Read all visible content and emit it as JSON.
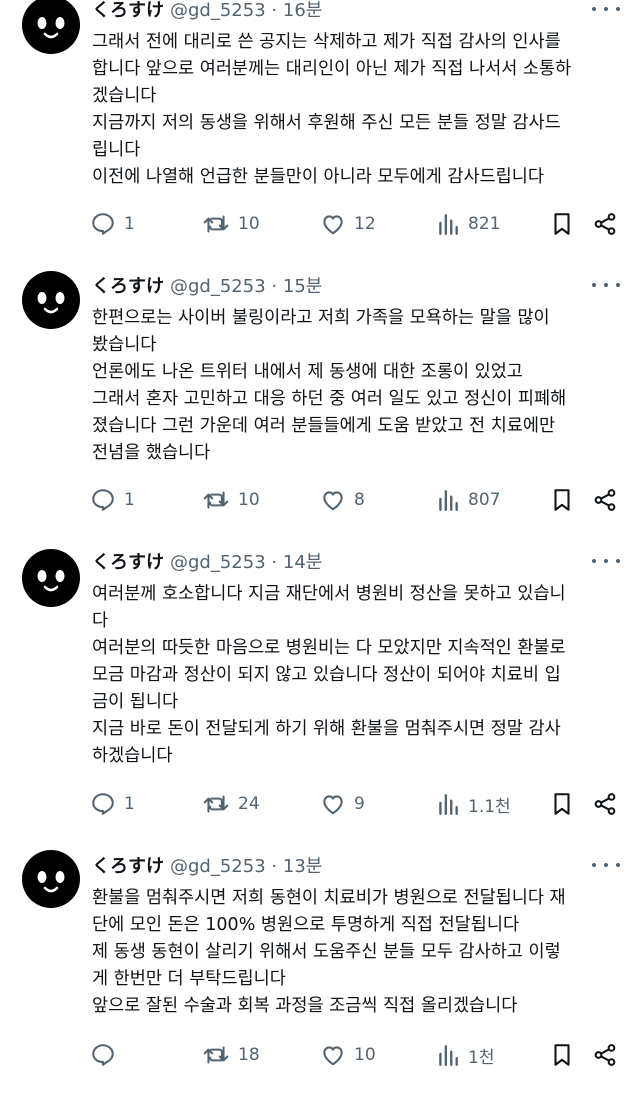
{
  "tweets": [
    {
      "name": "くろすけ",
      "handle": "@gd_5253",
      "dot": "·",
      "time": "16분",
      "lines": [
        "그래서 전에 대리로 쓴 공지는 삭제하고 제가 직접 감사의 인사를",
        "합니다 앞으로 여러분께는 대리인이 아닌 제가 직접 나서서 소통하",
        "겠습니다",
        "지금까지 저의 동생을 위해서 후원해 주신 모든 분들 정말 감사드",
        "립니다",
        "이전에 나열해 언급한 분들만이 아니라 모두에게 감사드립니다"
      ],
      "replies": "1",
      "retweets": "10",
      "likes": "12",
      "views": "821"
    },
    {
      "name": "くろすけ",
      "handle": "@gd_5253",
      "dot": "·",
      "time": "15분",
      "lines": [
        "한편으로는 사이버 불링이라고  저희 가족을 모욕하는 말을 많이",
        "봤습니다",
        "언론에도 나온 트위터 내에서 제 동생에 대한 조롱이 있었고",
        "그래서 혼자 고민하고 대응 하던 중 여러 일도 있고 정신이 피폐해",
        "졌습니다 그런 가운데 여러 분들들에게 도움 받았고 전 치료에만",
        "전념을 했습니다"
      ],
      "replies": "1",
      "retweets": "10",
      "likes": "8",
      "views": "807"
    },
    {
      "name": "くろすけ",
      "handle": "@gd_5253",
      "dot": "·",
      "time": "14분",
      "lines": [
        "여러분께 호소합니다 지금 재단에서 병원비 정산을 못하고 있습니",
        "다",
        "여러분의 따듯한 마음으로 병원비는 다 모았지만 지속적인 환불로",
        "모금 마감과 정산이 되지 않고 있습니다 정산이 되어야 치료비 입",
        "금이 됩니다",
        "지금 바로 돈이 전달되게 하기 위해 환불을 멈춰주시면 정말 감사",
        "하겠습니다"
      ],
      "replies": "1",
      "retweets": "24",
      "likes": "9",
      "views": "1.1천"
    },
    {
      "name": "くろすけ",
      "handle": "@gd_5253",
      "dot": "·",
      "time": "13분",
      "lines": [
        "환불을 멈춰주시면 저희 동현이 치료비가 병원으로 전달됩니다 재",
        "단에 모인 돈은 100% 병원으로 투명하게 직접 전달됩니다",
        "제 동생 동현이 살리기 위해서 도움주신 분들 모두 감사하고 이렇",
        "게 한번만 더 부탁드립니다",
        "앞으로 잘된 수술과 회복 과정을 조금씩 직접 올리겠습니다"
      ],
      "replies": "",
      "retweets": "18",
      "likes": "10",
      "views": "1천"
    }
  ]
}
